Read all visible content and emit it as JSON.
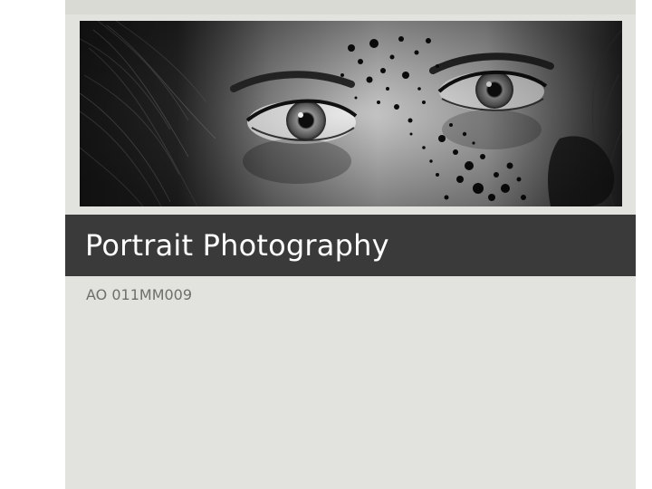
{
  "slide": {
    "title": "Portrait Photography",
    "subtitle": "AO 011MM009"
  },
  "image": {
    "description_icon": "portrait-eyes-image"
  },
  "colors": {
    "slide_background": "#e2e3de",
    "title_band": "#3a3a3a",
    "title_text": "#ffffff",
    "subtitle_text": "#6e6f69"
  }
}
